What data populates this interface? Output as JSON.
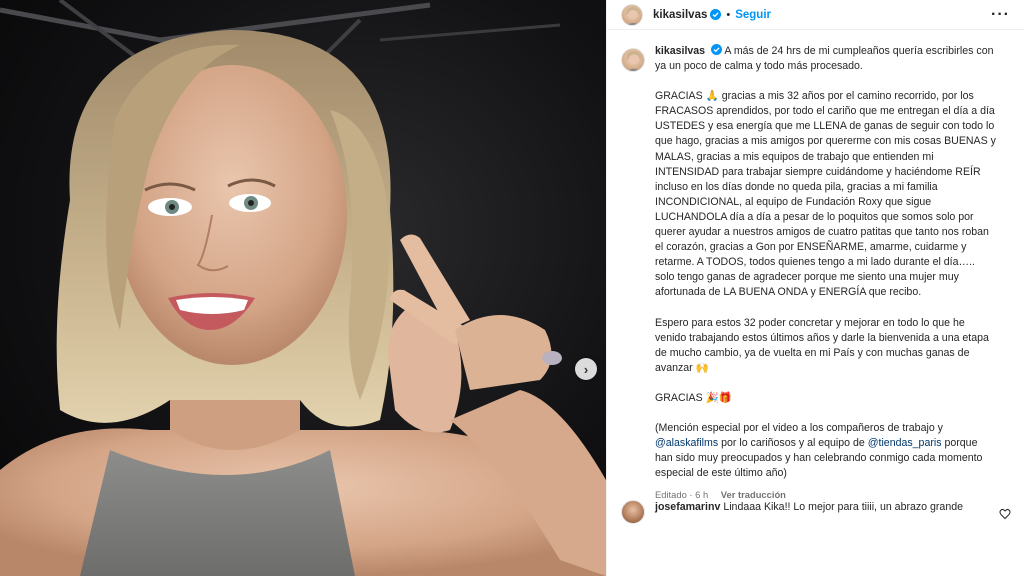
{
  "post": {
    "username": "kikasilvas",
    "separator": "•",
    "follow_label": "Seguir",
    "more_label": "···"
  },
  "carousel": {
    "next_label": "›"
  },
  "caption": {
    "username": "kikasilvas",
    "p1": "A más de 24 hrs de mi cumpleaños quería escribirles con ya un poco de calma y todo más procesado.",
    "p2": "GRACIAS 🙏 gracias a mis 32 años por el camino recorrido, por los FRACASOS aprendidos, por todo el cariño que me entregan el día a día USTEDES y esa energía que me LLENA de ganas de seguir con todo lo que hago, gracias a mis amigos por quererme con mis cosas BUENAS y MALAS, gracias a mis equipos de trabajo que entienden mi INTENSIDAD para trabajar siempre cuidándome y haciéndome REÍR incluso en los días donde no queda pila, gracias a mi familia INCONDICIONAL, al equipo de Fundación Roxy que sigue LUCHANDOLA día a día a pesar de lo poquitos que somos solo por querer ayudar a nuestros amigos de cuatro patitas que tanto nos roban el corazón, gracias a Gon por ENSEÑARME, amarme, cuidarme y retarme. A TODOS, todos quienes tengo a mi lado durante el día….. solo tengo ganas de agradecer porque me siento una mujer muy afortunada de LA BUENA ONDA y ENERGÍA que recibo.",
    "p3": "Espero para estos 32 poder concretar y mejorar en todo lo que he venido trabajando estos últimos años y darle la bienvenida a una etapa de mucho cambio, ya de vuelta en mi País y con muchas ganas de avanzar 🙌",
    "p4": "GRACIAS 🎉🎁",
    "p5a": "(Mención especial por el video a los compañeros de trabajo y ",
    "mention1": "@alaskafilms",
    "p5b": " por lo cariñosos y al equipo de ",
    "mention2": "@tiendas_paris",
    "p5c": " porque han sido muy preocupados y han celebrando conmigo cada momento especial de este último año)",
    "edited": "Editado · 6 h",
    "translate": "Ver traducción"
  },
  "comment": {
    "username": "josefamarinv",
    "text": "Lindaaa Kika!! Lo mejor para tiiii, un abrazo grande"
  },
  "colors": {
    "accent": "#0095f6",
    "verified": "#0095f6",
    "mention": "#00376b",
    "muted": "#737373"
  },
  "icons": [
    "verified-badge-icon",
    "more-options-icon",
    "carousel-next-icon",
    "heart-icon"
  ]
}
